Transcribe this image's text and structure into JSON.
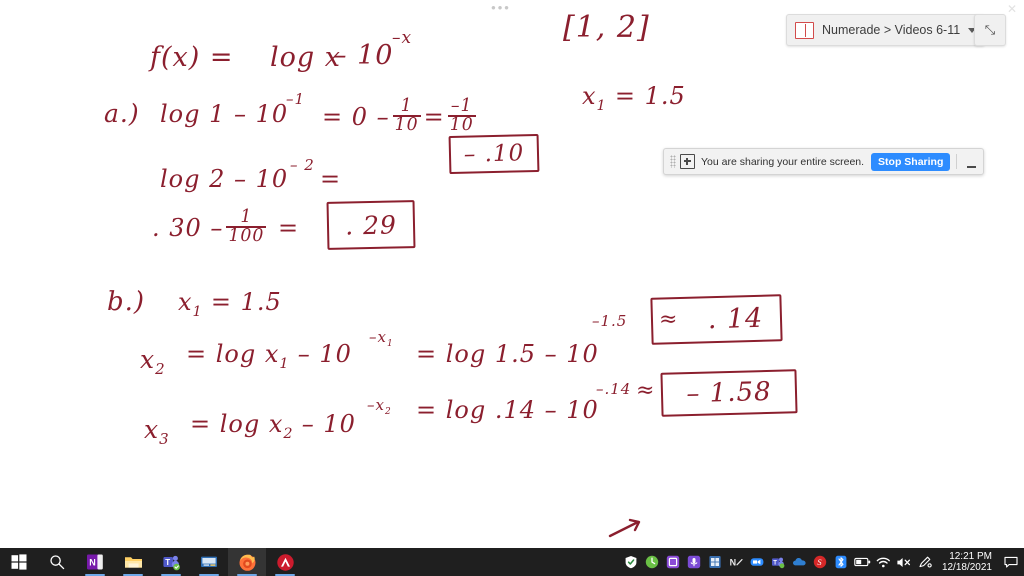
{
  "whiteboard": {
    "title_note": "handwritten math worksheet in dark red ink on white digital whiteboard",
    "ink_color": "#8b1f2e",
    "lines": {
      "function_label": "f(x) =",
      "function_body": "log x",
      "function_minus": "– 10",
      "function_exp": "–x",
      "interval": "[1, 2]",
      "x1_note_var": "x",
      "x1_note_sub": "1",
      "x1_note_val": "= 1.5",
      "a_label": "a.)",
      "a_line1_p1": "log 1  –  10",
      "a_line1_exp": "–1",
      "a_line1_p2": "=  0 –",
      "a_line1_frac_num": "1",
      "a_line1_frac_den": "10",
      "a_line1_p3": "=",
      "a_line1_frac2_num": "–1",
      "a_line1_frac2_den": "10",
      "a_answer1": "– .10",
      "a_line2_p1": "log 2 –  10",
      "a_line2_exp": "– 2",
      "a_line2_p2": "=",
      "a_line3_p1": ". 30  –",
      "a_line3_frac_num": "1",
      "a_line3_frac_den": "100",
      "a_line3_p2": "=",
      "a_answer2": ". 29",
      "b_label": "b.)",
      "b_x1_var": "x",
      "b_x1_sub": "1",
      "b_x1_val": "= 1.5",
      "b_line1_var": "x",
      "b_line1_sub": "2",
      "b_line1_eq": "=   log x",
      "b_line1_sub2": "1",
      "b_line1_minus": "– 10",
      "b_line1_exp": "–x",
      "b_line1_expsub": "1",
      "b_line1_rhs": "=  log 1.5  – 10",
      "b_line1_rhs_exp": "–1.5",
      "b_answer1_approx": "≈",
      "b_answer1": ". 14",
      "b_line2_var": "x",
      "b_line2_sub": "3",
      "b_line2_eq": "=   log x",
      "b_line2_sub2": "2",
      "b_line2_minus": "– 10",
      "b_line2_exp": "–x",
      "b_line2_expsub": "2",
      "b_line2_rhs": "=  log .14  – 10",
      "b_line2_rhs_exp": "–.14",
      "b_answer2_approx": "≈",
      "b_answer2": "– 1.58"
    }
  },
  "top_dots": "•••",
  "share_tab": {
    "label": "Numerade > Videos 6-11",
    "doc_icon": "document-icon",
    "caret_icon": "chevron-down-icon",
    "expand_icon": "⤡",
    "close_icon": "✕"
  },
  "sharing_bar": {
    "message": "You are sharing your entire screen.",
    "stop_button": "Stop Sharing",
    "share_icon": "screen-share-icon",
    "grip_icon": "drag-handle-icon",
    "minimize_icon": "minimize-icon",
    "accent_color": "#2d8cff"
  },
  "taskbar": {
    "left_items": [
      {
        "name": "start-button",
        "icon": "windows-logo-icon",
        "color": "#ffffff"
      },
      {
        "name": "search-button",
        "icon": "search-icon",
        "color": "#ffffff"
      },
      {
        "name": "onenote-app",
        "icon": "onenote-icon",
        "color": "#7719aa"
      },
      {
        "name": "file-explorer-app",
        "icon": "folder-icon",
        "color": "#ffd166"
      },
      {
        "name": "teams-app",
        "icon": "teams-icon",
        "color": "#5059c9"
      },
      {
        "name": "media-app",
        "icon": "media-player-icon",
        "color": "#2f6fb5"
      },
      {
        "name": "firefox-app",
        "icon": "firefox-icon",
        "color": "#ff7139"
      },
      {
        "name": "acrobat-app",
        "icon": "red-a-icon",
        "color": "#cc1b2d"
      }
    ],
    "tray_items": [
      {
        "name": "security-tray-icon",
        "icon": "shield-icon",
        "color": "#ffffff"
      },
      {
        "name": "updater-tray-icon",
        "icon": "circle-icon",
        "color": "#6ac045"
      },
      {
        "name": "screenshot-tray-icon",
        "icon": "capture-icon",
        "color": "#8a4bd6"
      },
      {
        "name": "microphone-tray-icon",
        "icon": "microphone-icon",
        "color": "#7b4bd6"
      },
      {
        "name": "excel-tray-icon",
        "icon": "excel-icon",
        "color": "#3a6fb0"
      },
      {
        "name": "nvidia-tray-icon",
        "icon": "nvidia-icon",
        "color": "#eaeaea"
      },
      {
        "name": "zoom-tray-icon",
        "icon": "zoom-icon",
        "color": "#2d8cff"
      },
      {
        "name": "teams-tray-icon",
        "icon": "teams-icon",
        "color": "#5059c9"
      },
      {
        "name": "onedrive-tray-icon",
        "icon": "cloud-icon",
        "color": "#2f7fd1"
      },
      {
        "name": "record-tray-icon",
        "icon": "record-icon",
        "color": "#d62828"
      },
      {
        "name": "bluetooth-tray-icon",
        "icon": "bluetooth-icon",
        "color": "#2d8cff"
      },
      {
        "name": "battery-tray-icon",
        "icon": "battery-icon",
        "color": "#ffffff"
      },
      {
        "name": "network-tray-icon",
        "icon": "wifi-icon",
        "color": "#ffffff"
      },
      {
        "name": "volume-tray-icon",
        "icon": "speaker-muted-icon",
        "color": "#ffffff"
      },
      {
        "name": "settings-tray-icon",
        "icon": "pen-settings-icon",
        "color": "#ffffff"
      }
    ],
    "clock": {
      "time": "12:21 PM",
      "date": "12/18/2021"
    },
    "notification_icon": "notification-icon"
  }
}
